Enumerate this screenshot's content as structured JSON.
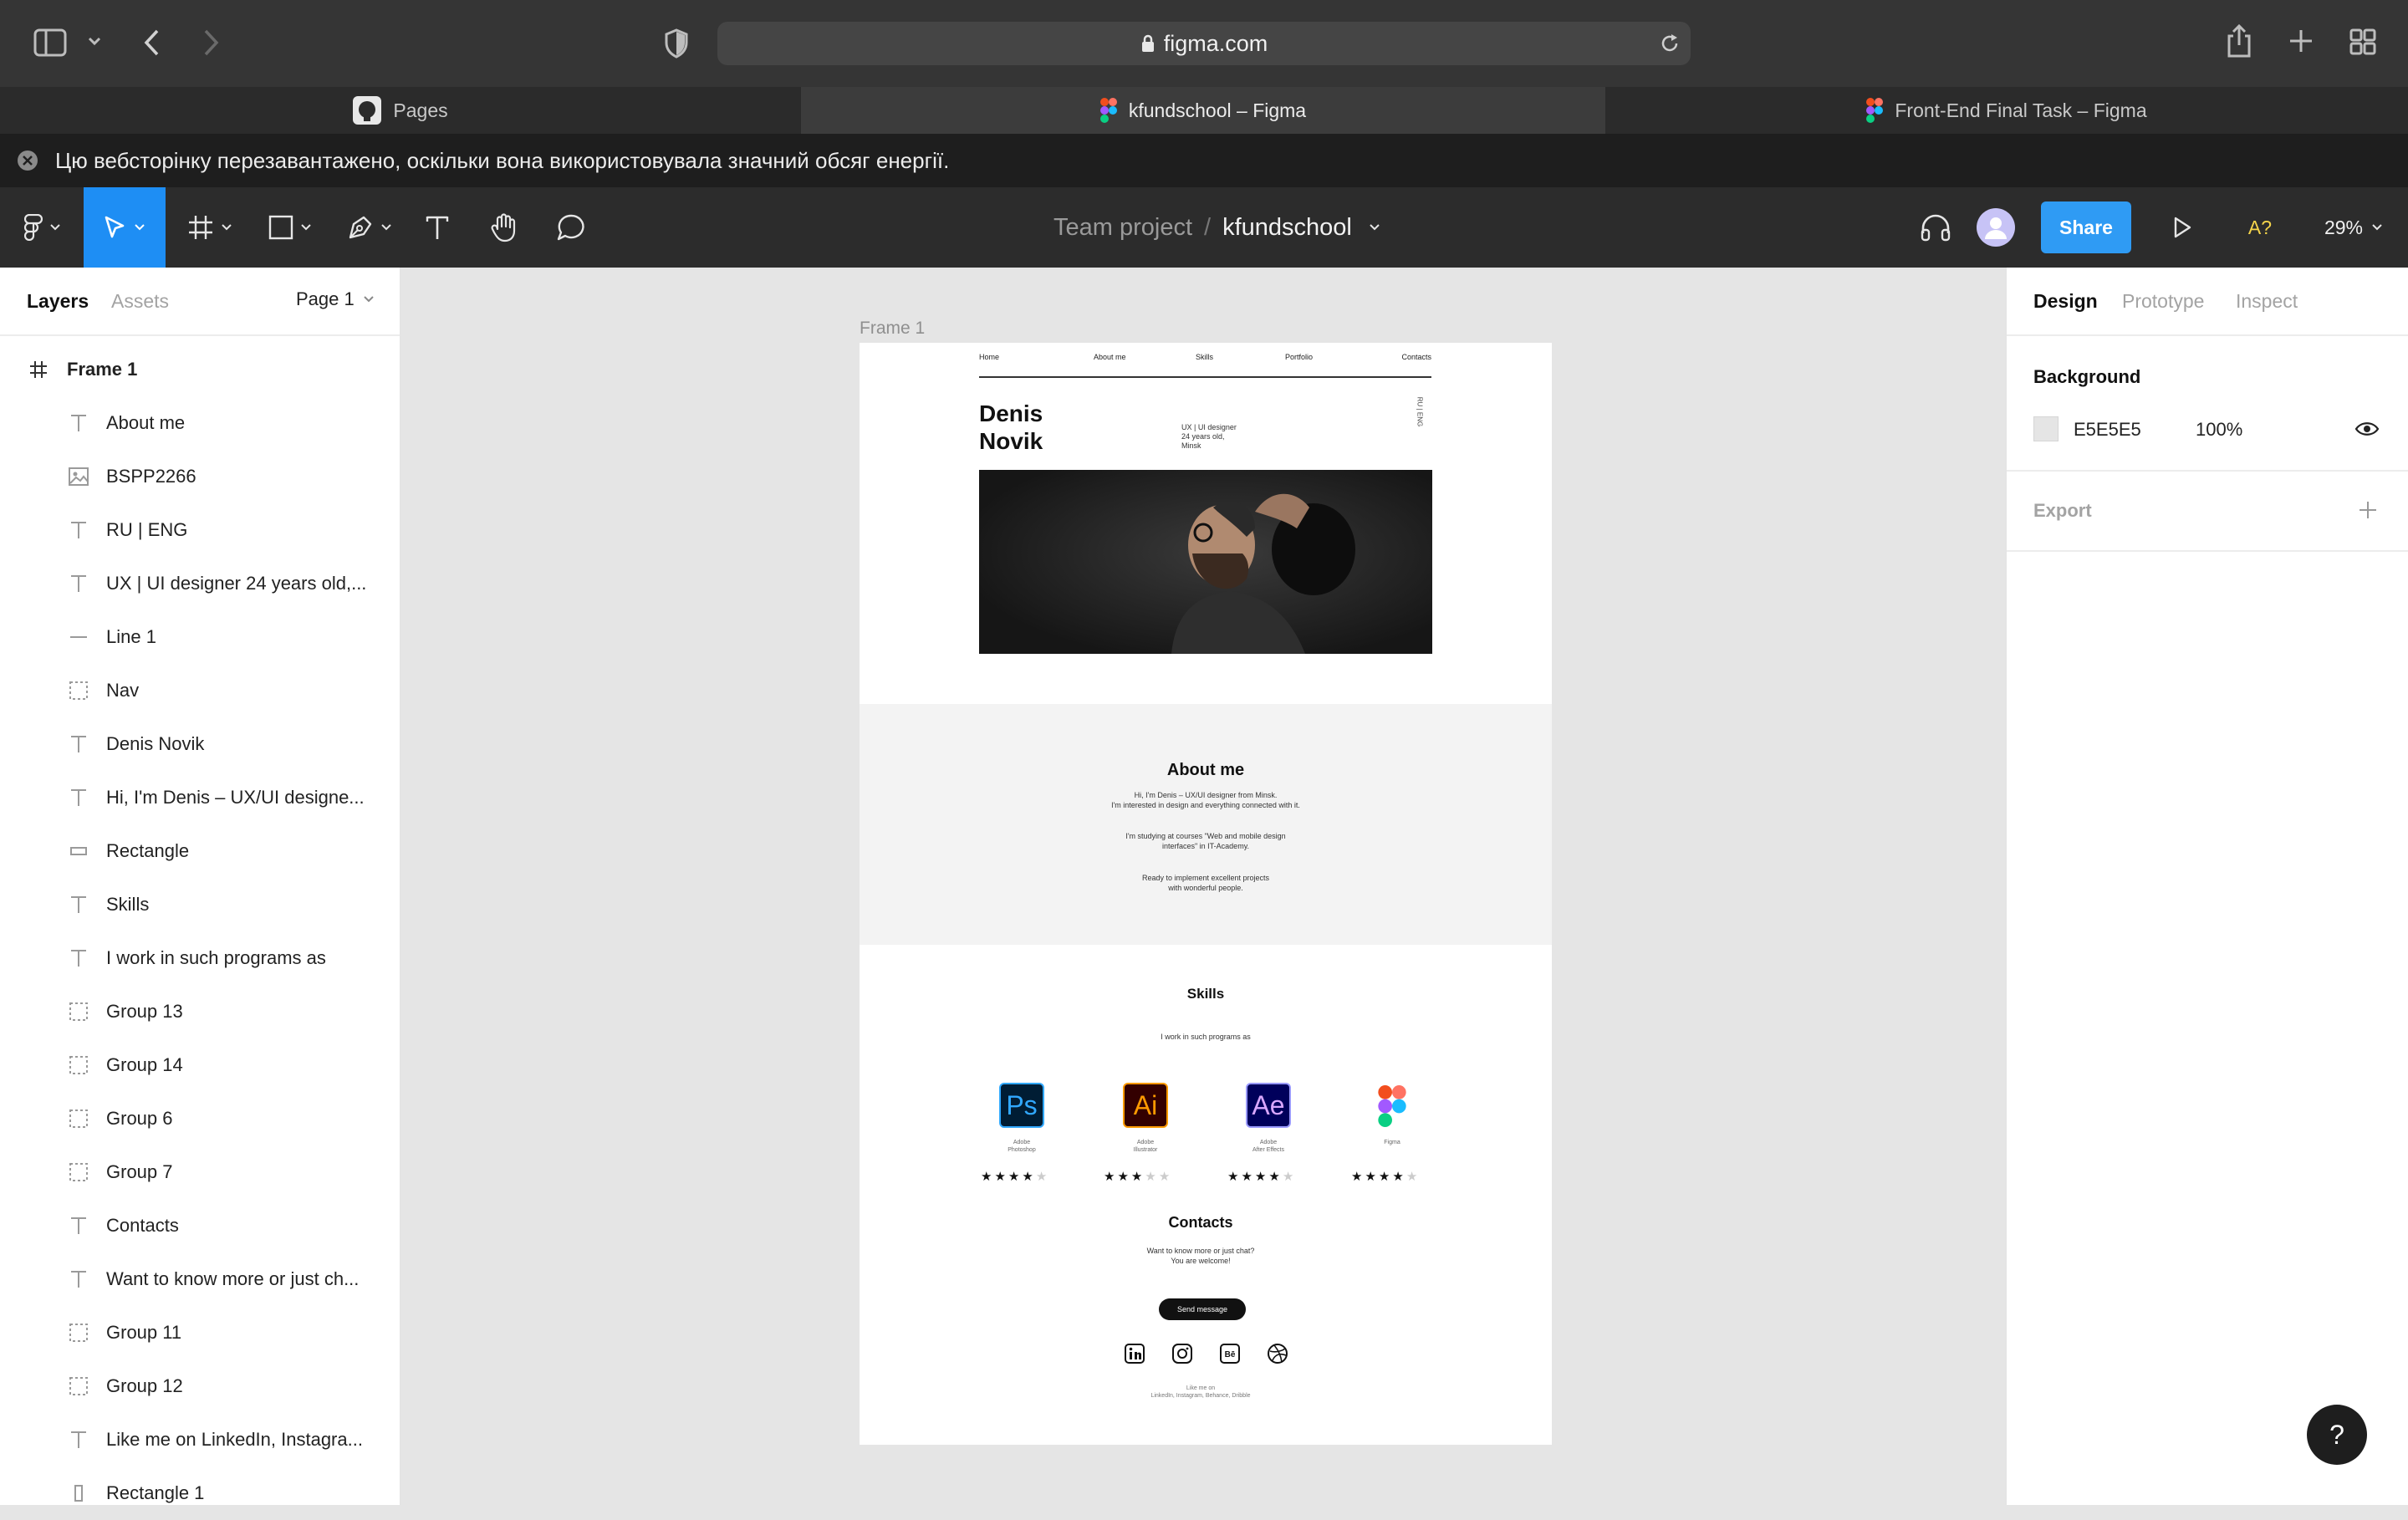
{
  "browser": {
    "address": "figma.com",
    "tabs": [
      {
        "label": "Pages",
        "icon": "github-icon",
        "active": false
      },
      {
        "label": "kfundschool – Figma",
        "icon": "figma-icon",
        "active": true
      },
      {
        "label": "Front-End Final Task – Figma",
        "icon": "figma-icon",
        "active": false
      }
    ],
    "notice": "Цю вебсторінку перезавантажено, оскільки вона використовувала значний обсяг енергії."
  },
  "figma_toolbar": {
    "project": "Team project",
    "separator": "/",
    "file": "kfundschool",
    "share_label": "Share",
    "font_missing": "A?",
    "zoom": "29%"
  },
  "left_panel": {
    "tab_layers": "Layers",
    "tab_assets": "Assets",
    "page": "Page 1",
    "frame_name": "Frame 1",
    "layers": [
      {
        "label": "About me",
        "icon": "text-icon"
      },
      {
        "label": "BSPP2266",
        "icon": "image-icon"
      },
      {
        "label": "RU | ENG",
        "icon": "text-icon"
      },
      {
        "label": "UX | UI designer 24 years old,...",
        "icon": "text-icon"
      },
      {
        "label": "Line 1",
        "icon": "line-icon"
      },
      {
        "label": "Nav",
        "icon": "group-icon"
      },
      {
        "label": "Denis Novik",
        "icon": "text-icon"
      },
      {
        "label": "Hi, I'm Denis – UX/UI designe...",
        "icon": "text-icon"
      },
      {
        "label": "Rectangle",
        "icon": "rectangle-icon"
      },
      {
        "label": "Skills",
        "icon": "text-icon"
      },
      {
        "label": "I work in such programs as",
        "icon": "text-icon"
      },
      {
        "label": "Group 13",
        "icon": "group-icon"
      },
      {
        "label": "Group 14",
        "icon": "group-icon"
      },
      {
        "label": "Group 6",
        "icon": "group-icon"
      },
      {
        "label": "Group 7",
        "icon": "group-icon"
      },
      {
        "label": "Contacts",
        "icon": "text-icon"
      },
      {
        "label": "Want to know more or just ch...",
        "icon": "text-icon"
      },
      {
        "label": "Group 11",
        "icon": "group-icon"
      },
      {
        "label": "Group 12",
        "icon": "group-icon"
      },
      {
        "label": "Like me on LinkedIn, Instagra...",
        "icon": "text-icon"
      },
      {
        "label": "Rectangle 1",
        "icon": "rectangle-icon"
      }
    ]
  },
  "canvas": {
    "frame_label": "Frame 1",
    "frame": {
      "nav": [
        "Home",
        "About me",
        "Skills",
        "Portfolio",
        "Contacts"
      ],
      "name_line1": "Denis",
      "name_line2": "Novik",
      "tagline": [
        "UX | UI designer",
        "24 years old,",
        "Minsk"
      ],
      "lang": "RU | ENG",
      "about_title": "About me",
      "about_p1": [
        "Hi, I'm Denis – UX/UI designer from Minsk.",
        "I'm interested in design and everything connected with it."
      ],
      "about_p2": [
        "I'm studying at courses \"Web and mobile design",
        "interfaces\" in IT-Academy."
      ],
      "about_p3": [
        "Ready to implement excellent projects",
        "with wonderful people."
      ],
      "skills_title": "Skills",
      "skills_sub": "I work in such programs as",
      "programs": [
        {
          "abbr": "Ps",
          "name1": "Adobe",
          "name2": "Photoshop",
          "rating": 4
        },
        {
          "abbr": "Ai",
          "name1": "Adobe",
          "name2": "Illustrator",
          "rating": 3
        },
        {
          "abbr": "Ae",
          "name1": "Adobe",
          "name2": "After Effects",
          "rating": 4
        },
        {
          "abbr": "",
          "name1": "Figma",
          "name2": "",
          "rating": 4
        }
      ],
      "contacts_title": "Contacts",
      "contacts_text": [
        "Want to know more or just chat?",
        "You are welcome!"
      ],
      "send_button": "Send message",
      "social_icons": [
        "linkedin-icon",
        "instagram-icon",
        "behance-icon",
        "dribbble-icon"
      ],
      "like_text": [
        "Like me on",
        "LinkedIn, Instagram, Behance, Dribble"
      ]
    }
  },
  "right_panel": {
    "tabs": [
      "Design",
      "Prototype",
      "Inspect"
    ],
    "background_label": "Background",
    "bg_hex": "E5E5E5",
    "bg_opacity": "100%",
    "export_label": "Export"
  },
  "help": "?",
  "colors": {
    "accent": "#2f9bf4",
    "figma_dark": "#2c2c2c",
    "canvas": "#e5e5e5",
    "font_warning": "#f5d44a"
  }
}
